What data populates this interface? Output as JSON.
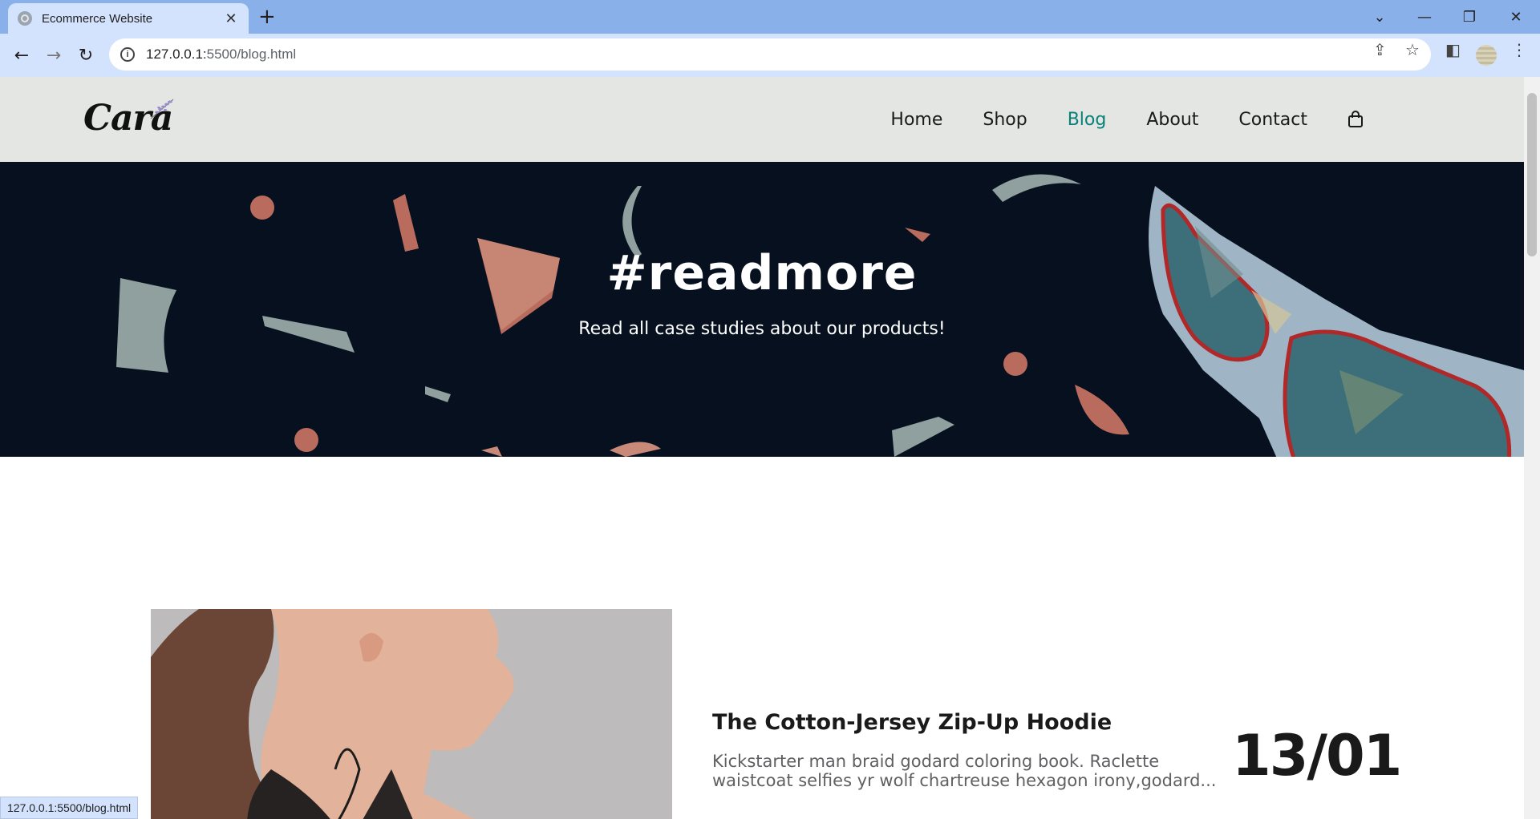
{
  "browser": {
    "tab_title": "Ecommerce Website",
    "tab_close": "✕",
    "new_tab": "+",
    "url_host": "127.0.0.1:",
    "url_rest": "5500/blog.html",
    "status_url": "127.0.0.1:5500/blog.html",
    "controls": {
      "dropdown": "⌄",
      "minimize": "—",
      "restore": "❐",
      "close": "✕"
    }
  },
  "site": {
    "logo": "Cara",
    "nav": [
      {
        "label": "Home"
      },
      {
        "label": "Shop"
      },
      {
        "label": "Blog",
        "active": true
      },
      {
        "label": "About"
      },
      {
        "label": "Contact"
      }
    ],
    "accent": "#088178"
  },
  "hero": {
    "title": "#readmore",
    "subtitle": "Read all case studies about our products!"
  },
  "blog": {
    "posts": [
      {
        "title": "The Cotton-Jersey Zip-Up Hoodie",
        "excerpt": "Kickstarter man braid godard coloring book. Raclette waistcoat selfies yr wolf chartreuse hexagon irony,godard...",
        "date": "13/01"
      }
    ]
  }
}
